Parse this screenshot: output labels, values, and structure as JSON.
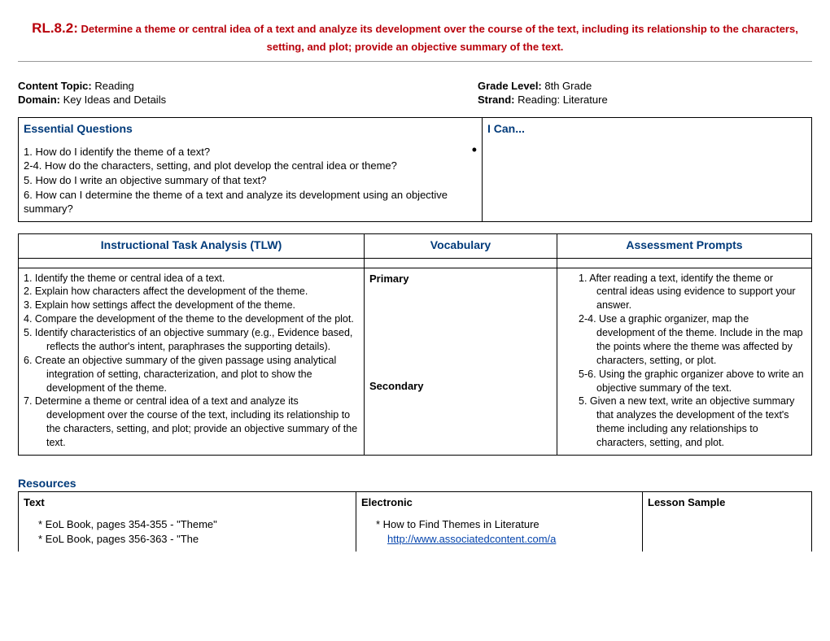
{
  "header": {
    "code": "RL.8.2:",
    "desc": "Determine a theme or central idea of a text and analyze its development over the course of the text, including its relationship to the characters, setting, and plot; provide an objective summary of the text."
  },
  "meta": {
    "content_topic_label": "Content Topic:",
    "content_topic_value": "  Reading",
    "grade_level_label": "Grade Level:",
    "grade_level_value": "  8th Grade",
    "domain_label": "Domain:",
    "domain_value": "  Key Ideas and Details",
    "strand_label": "Strand:",
    "strand_value": "  Reading: Literature"
  },
  "sections": {
    "essential_questions_title": "Essential Questions",
    "i_can_title": "I Can...",
    "eq_1": "1.    How do I identify the theme of a text?",
    "eq_2": "2-4. How do the characters, setting, and plot develop the central idea or theme?",
    "eq_5": "5.    How do I write an objective summary of that text?",
    "eq_6": "6.    How can I determine the theme of a text and analyze its development using an objective summary?",
    "ita_title": "Instructional Task Analysis  (TLW)",
    "vocab_title": "Vocabulary",
    "assess_title": "Assessment Prompts",
    "vocab_primary": "Primary",
    "vocab_secondary": "Secondary",
    "ita_1": "Identify the theme or central idea of a text.",
    "ita_2": "Explain how characters affect the development of the theme.",
    "ita_3": "Explain how settings affect the development of the theme.",
    "ita_4": "Compare the development of the theme to the development of the plot.",
    "ita_5": "Identify characteristics of an objective summary (e.g., Evidence based, reflects the author's intent, paraphrases the supporting details).",
    "ita_6": "Create an objective summary of the given passage using analytical integration of setting, characterization, and plot to show the development of the theme.",
    "ita_7": "Determine a theme or central idea of a text and analyze its development over the course of the text, including its relationship to the characters, setting, and plot; provide an objective summary of the text.",
    "ap_1": "1. After reading a text, identify the theme or central ideas using evidence to support your answer.",
    "ap_2": "2-4. Use a graphic organizer, map the development of the theme. Include in the map the points where the theme was affected by characters, setting, or plot.",
    "ap_3": "5-6. Using the graphic organizer above to write an objective summary of the text.",
    "ap_4": "5. Given a new text, write an objective summary that analyzes the development of the text's theme including any relationships to characters, setting, and plot.",
    "resources_title": "Resources",
    "res_text_label": "Text",
    "res_elec_label": "Electronic",
    "res_lesson_label": "Lesson Sample",
    "res_text_1": "*  EoL Book, pages 354-355 - \"Theme\"",
    "res_text_2": "*  EoL Book, pages 356-363 - \"The",
    "res_elec_1": "*  How to Find Themes in Literature",
    "res_elec_link": "http://www.associatedcontent.com/a"
  }
}
